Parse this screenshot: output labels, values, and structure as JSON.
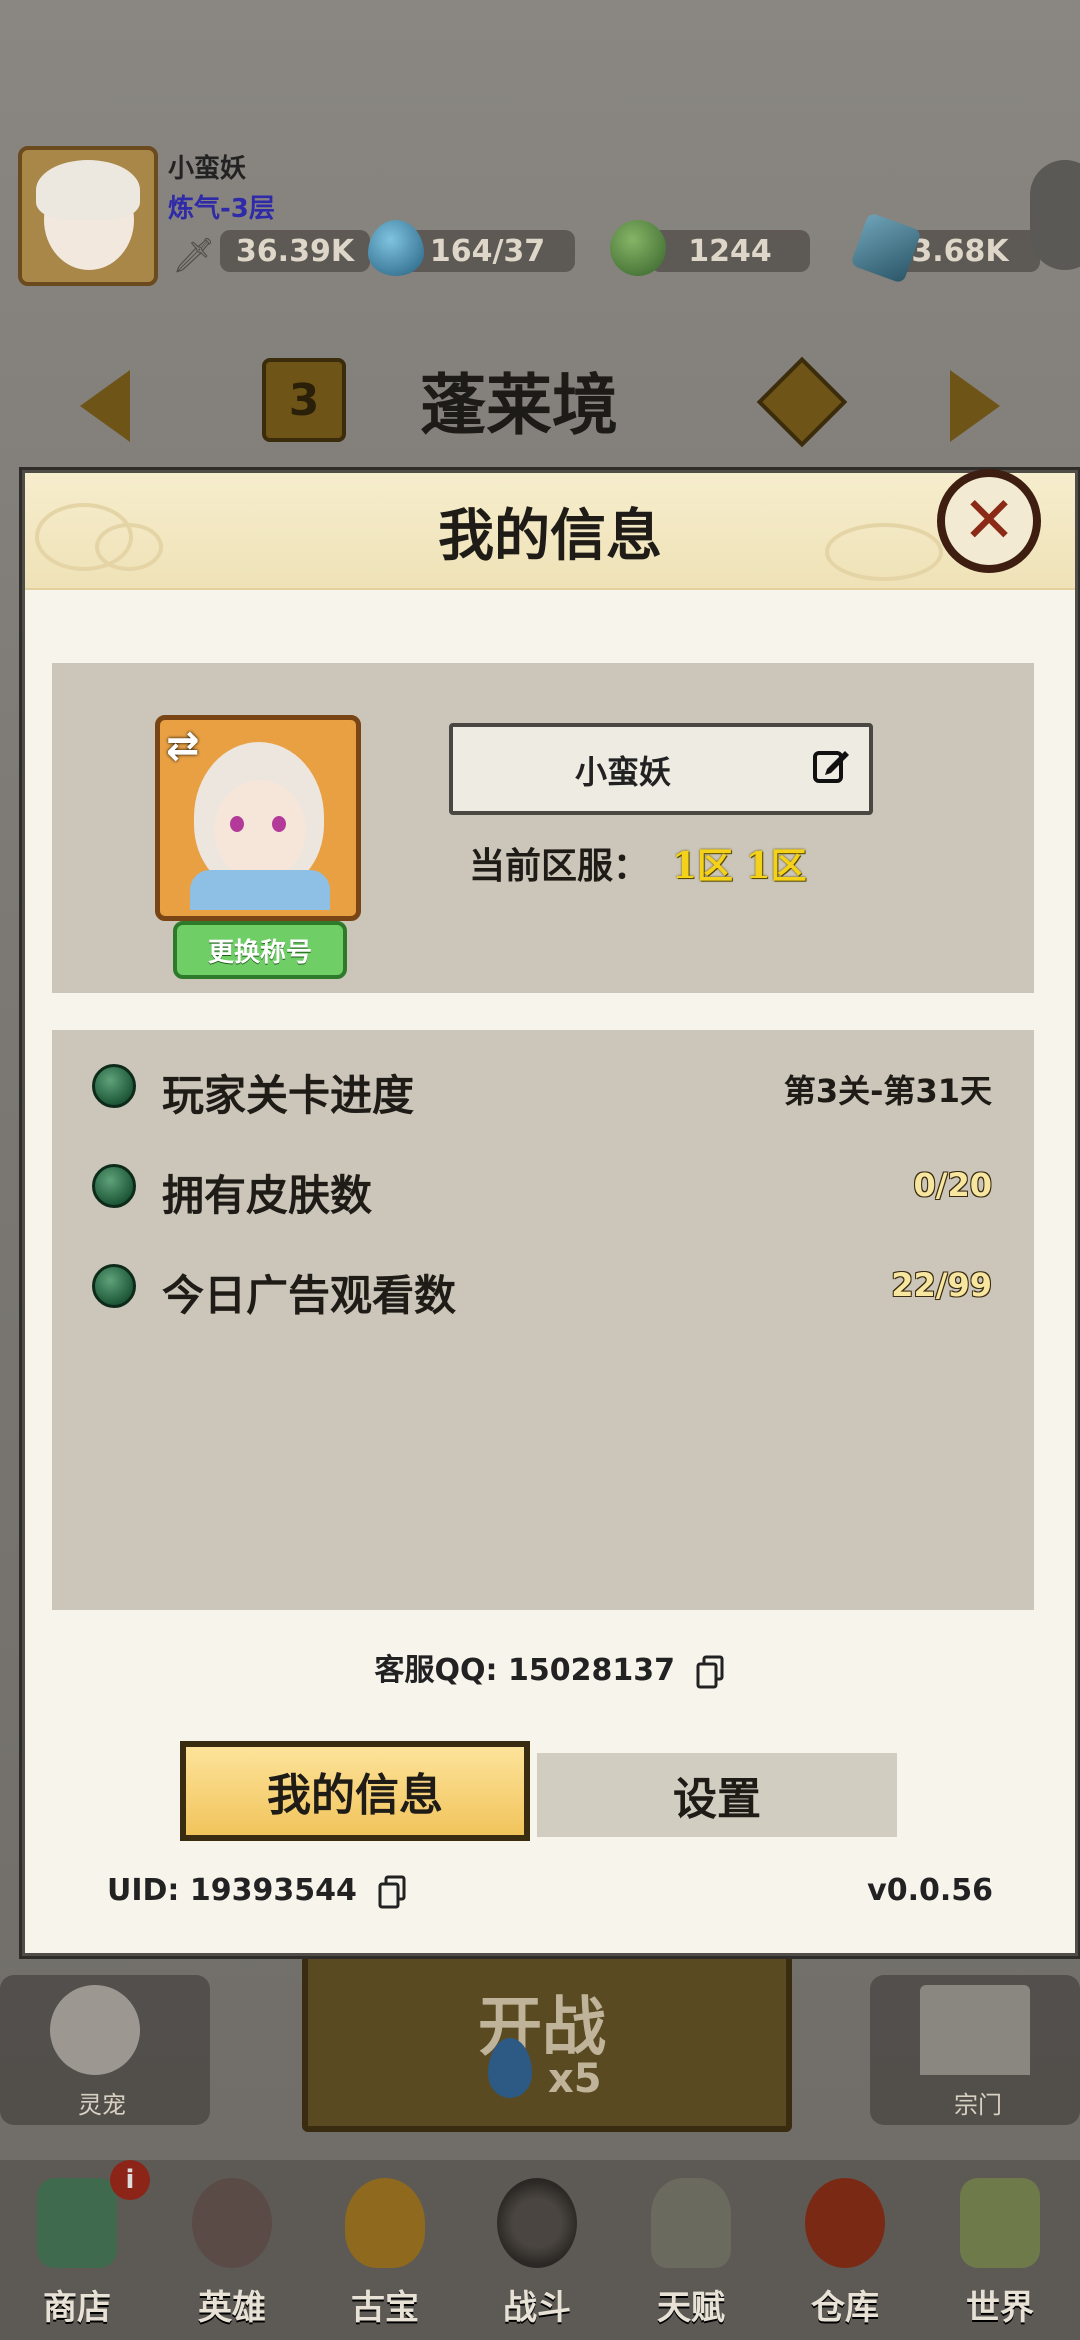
{
  "background": {
    "player": {
      "name": "小蛮妖",
      "level": "炼气-3层"
    },
    "resources": [
      {
        "icon": "sword-power-icon",
        "value": "36.39K"
      },
      {
        "icon": "water-drop-icon",
        "value": "164/37"
      },
      {
        "icon": "money-bag-icon",
        "value": "1244"
      },
      {
        "icon": "crystal-icon",
        "value": "3.68K"
      }
    ],
    "stage": {
      "number": "3",
      "title": "蓬莱境"
    },
    "side_buttons": {
      "pet": "灵宠",
      "sect": "宗门"
    },
    "fight": {
      "label": "开战",
      "cost": "x5"
    },
    "nav": {
      "shop": "商店",
      "shop_badge": "i",
      "hero": "英雄",
      "treasure": "古宝",
      "battle": "战斗",
      "talent": "天赋",
      "warehouse": "仓库",
      "world": "世界"
    }
  },
  "modal": {
    "title": "我的信息",
    "profile": {
      "name": "小蛮妖",
      "change_title_label": "更换称号",
      "server_label": "当前区服：",
      "server_value": "1区 1区"
    },
    "stats": [
      {
        "label": "玩家关卡进度",
        "value": "第3关-第31天"
      },
      {
        "label": "拥有皮肤数",
        "value": "0/20"
      },
      {
        "label": "今日广告观看数",
        "value": "22/99"
      }
    ],
    "service_qq": "客服QQ: 15028137",
    "tabs": {
      "info": "我的信息",
      "settings": "设置"
    },
    "uid": "UID: 19393544",
    "version": "v0.0.56"
  },
  "colors": {
    "accent_gold": "#f5d21a",
    "tab_active": "#f1c45c",
    "panel_bg": "#cbc6b9",
    "change_title_green": "#6fcf66",
    "close_red": "#8a2a17"
  }
}
